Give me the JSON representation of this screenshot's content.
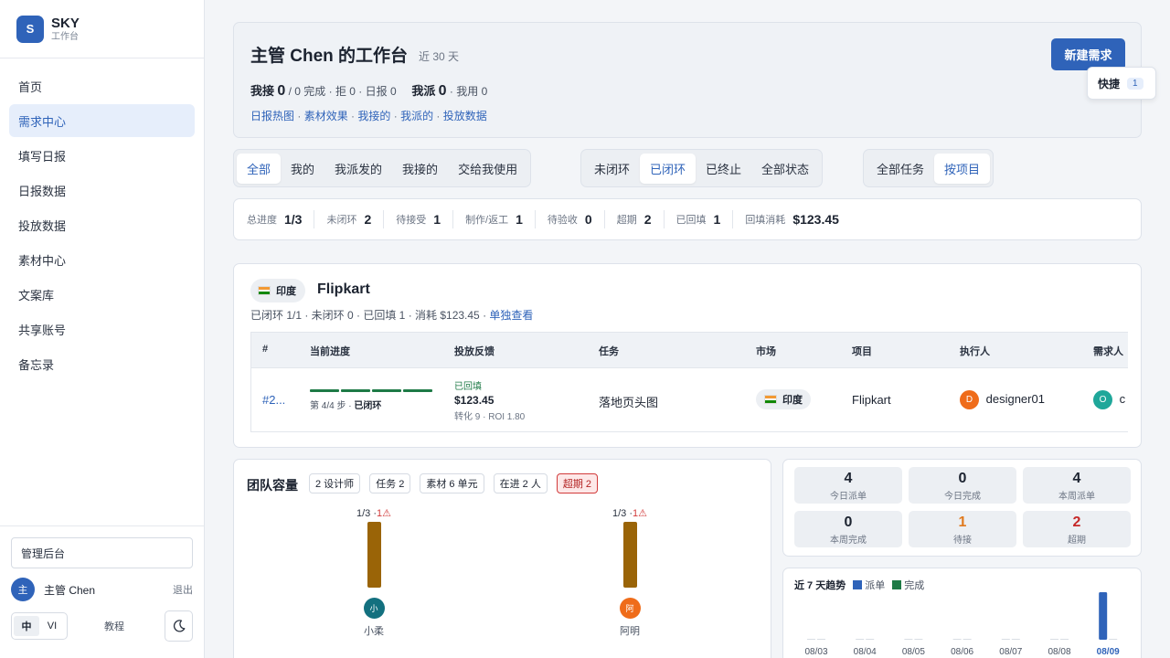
{
  "brand": {
    "logo_letter": "S",
    "name": "SKY",
    "subtitle": "工作台"
  },
  "nav": [
    {
      "label": "首页",
      "active": false
    },
    {
      "label": "需求中心",
      "active": true
    },
    {
      "label": "填写日报",
      "active": false
    },
    {
      "label": "日报数据",
      "active": false
    },
    {
      "label": "投放数据",
      "active": false
    },
    {
      "label": "素材中心",
      "active": false
    },
    {
      "label": "文案库",
      "active": false
    },
    {
      "label": "共享账号",
      "active": false
    },
    {
      "label": "备忘录",
      "active": false
    }
  ],
  "sidebar_bottom": {
    "admin_label": "管理后台",
    "user_avatar": "主",
    "user_name": "主管 Chen",
    "logout_label": "退出",
    "lang_options": [
      "中",
      "VI"
    ],
    "lang_selected": "中",
    "tutorial_label": "教程",
    "theme_icon": "moon-icon"
  },
  "header": {
    "title": "主管 Chen 的工作台",
    "range": "近 30 天",
    "stat_received_label": "我接",
    "stat_received_value": "0",
    "stat_received_rest": "/ 0 完成 · 拒 0 · 日报 0",
    "stat_assigned_label": "我派",
    "stat_assigned_value": "0",
    "stat_assigned_rest": "· 我用 0",
    "links": [
      "日报热图",
      "素材效果",
      "我接的",
      "我派的",
      "投放数据"
    ],
    "new_button": "新建需求",
    "quick_label": "快捷",
    "quick_count": "1"
  },
  "filters": {
    "scope": {
      "options": [
        "全部",
        "我的",
        "我派发的",
        "我接的",
        "交给我使用"
      ],
      "selected": "全部"
    },
    "status": {
      "options": [
        "未闭环",
        "已闭环",
        "已终止",
        "全部状态"
      ],
      "selected": "已闭环"
    },
    "grouping": {
      "options": [
        "全部任务",
        "按项目"
      ],
      "selected": "按项目"
    }
  },
  "summary": [
    {
      "label": "总进度",
      "value": "1/3"
    },
    {
      "label": "未闭环",
      "value": "2"
    },
    {
      "label": "待接受",
      "value": "1"
    },
    {
      "label": "制作/返工",
      "value": "1"
    },
    {
      "label": "待验收",
      "value": "0"
    },
    {
      "label": "超期",
      "value": "2"
    },
    {
      "label": "已回填",
      "value": "1"
    },
    {
      "label": "回填消耗",
      "value": "$123.45"
    }
  ],
  "project": {
    "market": "印度",
    "name": "Flipkart",
    "meta": "已闭环 1/1 · 未闭环 0 · 已回填 1 · 消耗 $123.45 ·",
    "detail_link": "单独查看",
    "columns": [
      "#",
      "当前进度",
      "投放反馈",
      "任务",
      "市场",
      "项目",
      "执行人",
      "需求人"
    ],
    "rows": [
      {
        "id": "#2...",
        "progress_steps": 4,
        "progress_done": 4,
        "progress_text": "第 4/4 步 ·",
        "progress_status": "已闭环",
        "feedback_status": "已回填",
        "feedback_amount": "$123.45",
        "feedback_conv": "转化 9 · ROI 1.80",
        "task": "落地页头图",
        "market": "印度",
        "project": "Flipkart",
        "executor_avatar": "D",
        "executor": "designer01",
        "requester_avatar": "O",
        "requester": "c"
      }
    ]
  },
  "team": {
    "title": "团队容量",
    "chips": [
      {
        "label": "2 设计师",
        "warn": false
      },
      {
        "label": "任务 2",
        "warn": false
      },
      {
        "label": "素材 6 单元",
        "warn": false
      },
      {
        "label": "在进 2 人",
        "warn": false
      },
      {
        "label": "超期 2",
        "warn": true
      }
    ],
    "members": [
      {
        "ratio": "1/3 ·",
        "overdue": "1",
        "avatar": "小",
        "name": "小柔",
        "color": "#13707f"
      },
      {
        "ratio": "1/3 ·",
        "overdue": "1",
        "avatar": "阿",
        "name": "阿明",
        "color": "#ef6c1a"
      }
    ]
  },
  "kpis": [
    {
      "value": "4",
      "label": "今日派单",
      "color": "#1c2330"
    },
    {
      "value": "0",
      "label": "今日完成",
      "color": "#1c2330"
    },
    {
      "value": "4",
      "label": "本周派单",
      "color": "#1c2330"
    },
    {
      "value": "0",
      "label": "本周完成",
      "color": "#1c2330"
    },
    {
      "value": "1",
      "label": "待接",
      "color": "#e07a1f"
    },
    {
      "value": "2",
      "label": "超期",
      "color": "#c62828"
    }
  ],
  "colors": {
    "accent": "#2f63b9",
    "done": "#1e7a46",
    "bar": "#9a6407"
  },
  "chart_data": {
    "type": "bar",
    "title": "近 7 天趋势",
    "categories": [
      "08/03",
      "08/04",
      "08/05",
      "08/06",
      "08/07",
      "08/08",
      "08/09"
    ],
    "highlight": "08/09",
    "series": [
      {
        "name": "派单",
        "color": "#2f63b9",
        "values": [
          0,
          0,
          0,
          0,
          0,
          0,
          4
        ]
      },
      {
        "name": "完成",
        "color": "#1e7a46",
        "values": [
          0,
          0,
          0,
          0,
          0,
          0,
          0
        ]
      }
    ],
    "ylim": [
      0,
      4
    ],
    "legend": "top"
  }
}
